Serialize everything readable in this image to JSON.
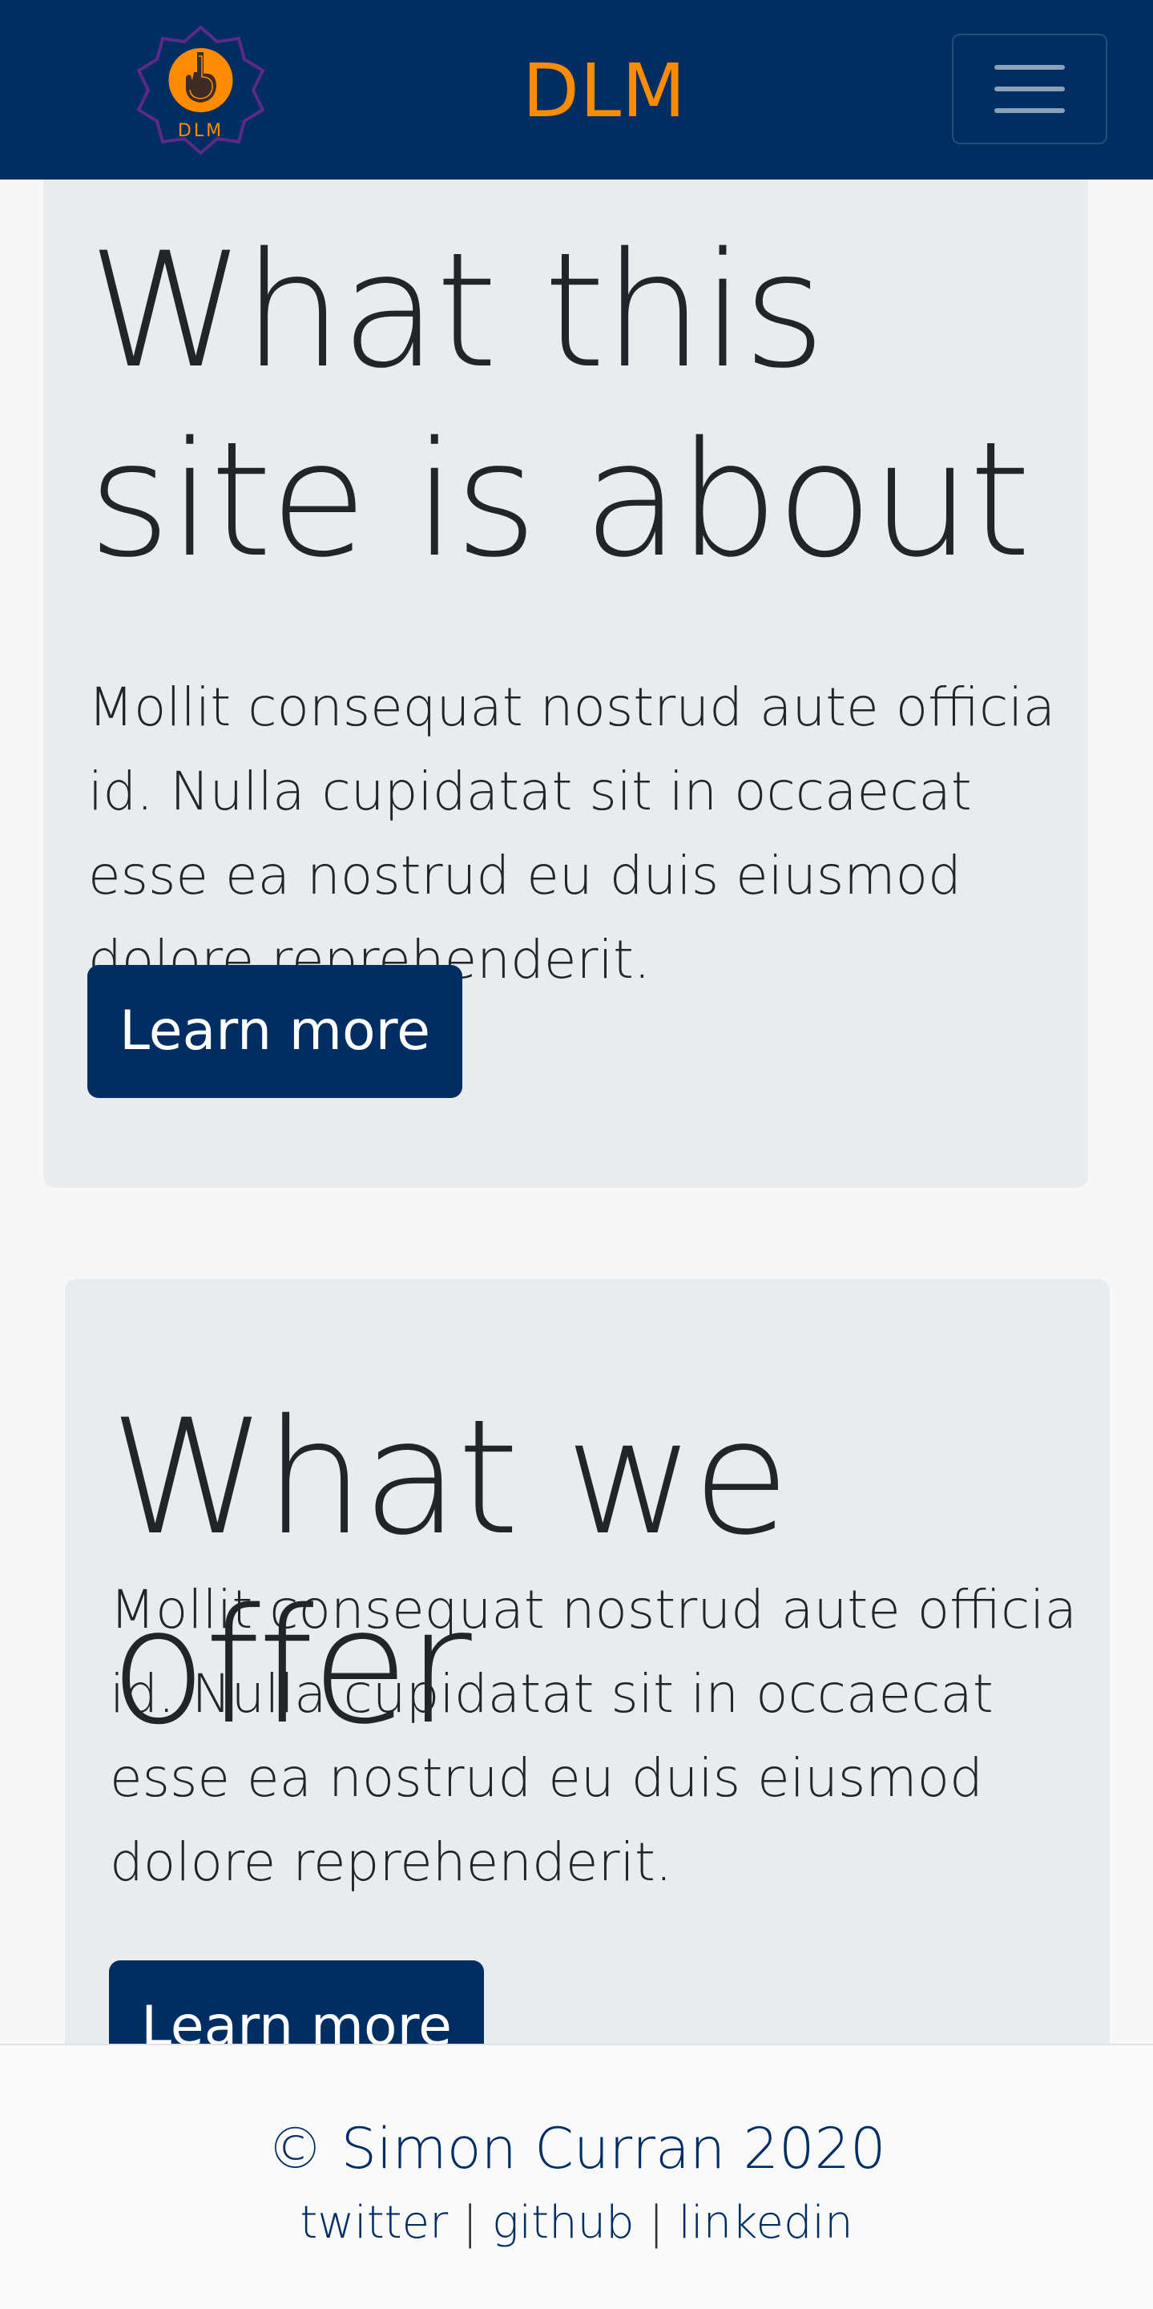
{
  "navbar": {
    "brand": "DLM",
    "logo_text": "DLM",
    "brand_color": "#ff8c00",
    "background_color": "#002d62",
    "toggler_icon": "hamburger-menu-icon"
  },
  "sections": [
    {
      "heading": "What this site is about",
      "body": "Mollit consequat nostrud aute officia id. Nulla cupidatat sit in occaecat esse ea nostrud eu duis eiusmod dolore reprehenderit.",
      "button_label": "Learn more"
    },
    {
      "heading": "What we offer",
      "body": "Mollit consequat nostrud aute officia id. Nulla cupidatat sit in occaecat esse ea nostrud eu duis eiusmod dolore reprehenderit.",
      "button_label": "Learn more"
    }
  ],
  "footer": {
    "copyright": "© Simon Curran 2020",
    "links": [
      "twitter",
      "github",
      "linkedin"
    ],
    "separator": "|"
  }
}
